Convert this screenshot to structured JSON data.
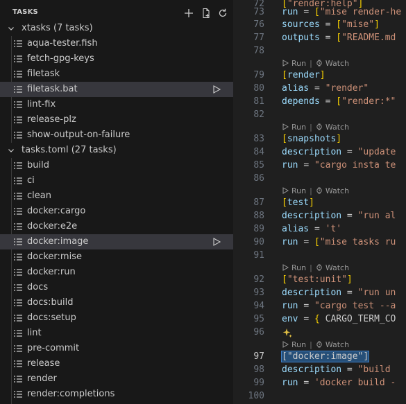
{
  "sidebar": {
    "title": "TASKS",
    "header_icons": [
      "add-icon",
      "new-file-icon",
      "refresh-icon"
    ],
    "groups": [
      {
        "label": "xtasks (7 tasks)",
        "expanded": true,
        "tasks": [
          {
            "label": "aqua-tester.fish",
            "selected": false
          },
          {
            "label": "fetch-gpg-keys",
            "selected": false
          },
          {
            "label": "filetask",
            "selected": false
          },
          {
            "label": "filetask.bat",
            "selected": true
          },
          {
            "label": "lint-fix",
            "selected": false
          },
          {
            "label": "release-plz",
            "selected": false
          },
          {
            "label": "show-output-on-failure",
            "selected": false
          }
        ]
      },
      {
        "label": "tasks.toml (27 tasks)",
        "expanded": true,
        "tasks": [
          {
            "label": "build",
            "selected": false
          },
          {
            "label": "ci",
            "selected": false
          },
          {
            "label": "clean",
            "selected": false
          },
          {
            "label": "docker:cargo",
            "selected": false
          },
          {
            "label": "docker:e2e",
            "selected": false
          },
          {
            "label": "docker:image",
            "selected": true
          },
          {
            "label": "docker:mise",
            "selected": false
          },
          {
            "label": "docker:run",
            "selected": false
          },
          {
            "label": "docs",
            "selected": false
          },
          {
            "label": "docs:build",
            "selected": false
          },
          {
            "label": "docs:setup",
            "selected": false
          },
          {
            "label": "lint",
            "selected": false
          },
          {
            "label": "pre-commit",
            "selected": false
          },
          {
            "label": "release",
            "selected": false
          },
          {
            "label": "render",
            "selected": false
          },
          {
            "label": "render:completions",
            "selected": false
          }
        ]
      }
    ]
  },
  "editor": {
    "codelens": {
      "run": "Run",
      "sep": "|",
      "watch": "Watch"
    },
    "lines": [
      {
        "n": "72",
        "text": "[\"render:help\"]"
      },
      {
        "n": "73",
        "text": "run = [\"mise render-he"
      },
      {
        "n": "76",
        "text": "sources = [\"mise\"]"
      },
      {
        "n": "77",
        "text": "outputs = [\"README.md"
      },
      {
        "n": "78",
        "text": ""
      },
      {
        "n": "79",
        "text": "[render]"
      },
      {
        "n": "80",
        "text": "alias = \"render\""
      },
      {
        "n": "81",
        "text": "depends = [\"render:*\""
      },
      {
        "n": "82",
        "text": ""
      },
      {
        "n": "83",
        "text": "[snapshots]"
      },
      {
        "n": "84",
        "text": "description = \"update"
      },
      {
        "n": "85",
        "text": "run = \"cargo insta te"
      },
      {
        "n": "86",
        "text": ""
      },
      {
        "n": "87",
        "text": "[test]"
      },
      {
        "n": "88",
        "text": "description = \"run al"
      },
      {
        "n": "89",
        "text": "alias = 't'"
      },
      {
        "n": "90",
        "text": "run = [\"mise tasks ru"
      },
      {
        "n": "91",
        "text": ""
      },
      {
        "n": "92",
        "text": "[\"test:unit\"]"
      },
      {
        "n": "93",
        "text": "description = \"run un"
      },
      {
        "n": "94",
        "text": "run = \"cargo test --a"
      },
      {
        "n": "95",
        "text": "env = { CARGO_TERM_CO"
      },
      {
        "n": "96",
        "text": ""
      },
      {
        "n": "97",
        "text": "[\"docker:image\"]"
      },
      {
        "n": "98",
        "text": "description = \"build"
      },
      {
        "n": "99",
        "text": "run = 'docker build -"
      },
      {
        "n": "100",
        "text": ""
      }
    ]
  }
}
